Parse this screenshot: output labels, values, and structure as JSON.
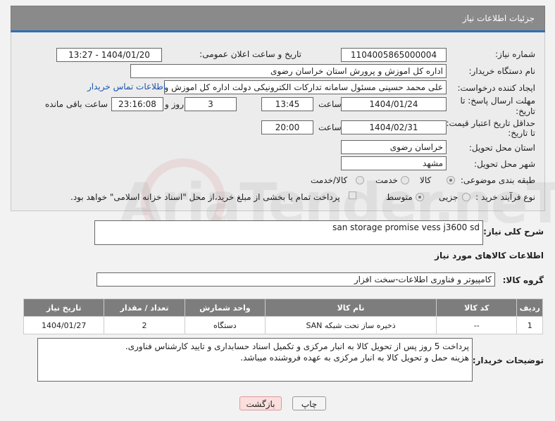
{
  "header": {
    "title": "جزئیات اطلاعات نیاز"
  },
  "form": {
    "need_number_label": "شماره نیاز:",
    "need_number": "1104005865000004",
    "announce_label": "تاریخ و ساعت اعلان عمومی:",
    "announce_value": "1404/01/20 - 13:27",
    "buyer_org_label": "نام دستگاه خریدار:",
    "buyer_org": "اداره کل اموزش و پرورش استان خراسان رضوی",
    "creator_label": "ایجاد کننده درخواست:",
    "creator": "علی محمد حسینی مسئول سامانه تدارکات الکترونیکی دولت اداره کل اموزش و",
    "contact_link": "اطلاعات تماس خریدار",
    "deadline_label_1": "مهلت ارسال پاسخ: تا",
    "deadline_label_2": "تاریخ:",
    "deadline_date": "1404/01/24",
    "time_label": "ساعت",
    "deadline_time": "13:45",
    "days_value": "3",
    "days_label": "روز و",
    "remaining_time": "23:16:08",
    "remaining_label": "ساعت باقی مانده",
    "validity_label_1": "حداقل تاریخ اعتبار قیمت:",
    "validity_label_2": "تا تاریخ:",
    "validity_date": "1404/02/31",
    "validity_time_label": "ساعت",
    "validity_time": "20:00",
    "province_label": "استان محل تحویل:",
    "province": "خراسان رضوی",
    "city_label": "شهر محل تحویل:",
    "city": "مشهد",
    "category_label": "طبقه بندی موضوعی:",
    "category_options": [
      "کالا",
      "خدمت",
      "کالا/خدمت"
    ],
    "category_selected": "کالا",
    "process_label": "نوع فرآیند خرید :",
    "process_options": [
      "جزیی",
      "متوسط"
    ],
    "process_selected": "متوسط",
    "payment_note": "پرداخت تمام یا بخشی از مبلغ خرید،از محل \"اسناد خزانه اسلامی\" خواهد بود."
  },
  "description": {
    "label": "شرح کلی نیاز:",
    "value": "san storage promise vess j3600 sd"
  },
  "goods_section": {
    "title": "اطلاعات کالاهای مورد نیاز",
    "group_label": "گروه کالا:",
    "group_value": "کامپیوتر و فناوری اطلاعات-سخت افزار"
  },
  "table": {
    "headers": [
      "ردیف",
      "کد کالا",
      "نام کالا",
      "واحد شمارش",
      "تعداد / مقدار",
      "تاریخ نیاز"
    ],
    "rows": [
      [
        "1",
        "--",
        "ذخیره ساز تحت شبکه SAN",
        "دستگاه",
        "2",
        "1404/01/27"
      ]
    ]
  },
  "buyer_notes": {
    "label": "توضیحات خریدار:",
    "line1": "پرداخت 5 روز پس از تحویل کالا به انبار مرکزی و تکمیل اسناد حسابداری و تایید کارشناس فناوری.",
    "line2": "هزینه حمل و تحویل کالا به انبار مرکزی به عهده فروشنده میباشد."
  },
  "buttons": {
    "print": "چاپ",
    "back": "بازگشت"
  },
  "watermark": {
    "text": "AriaTender.neT"
  }
}
